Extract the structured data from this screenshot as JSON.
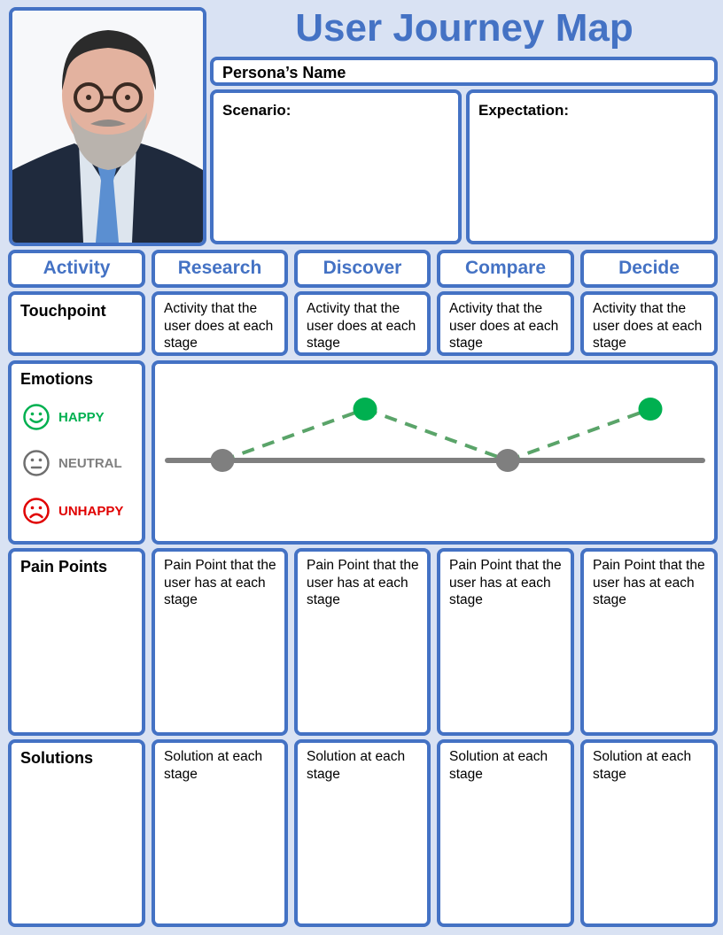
{
  "header": {
    "title": "User Journey Map",
    "persona_name_label": "Persona’s Name",
    "scenario_label": "Scenario:",
    "expectation_label": "Expectation:"
  },
  "photo": {
    "icon": "persona-photo",
    "alt": "Persona photo"
  },
  "activity_header": "Activity",
  "stages": [
    "Research",
    "Discover",
    "Compare",
    "Decide"
  ],
  "touchpoint": {
    "label": "Touchpoint",
    "cells": [
      "Activity that the user does at each stage",
      "Activity that the user does at each stage",
      "Activity that the user does at each stage",
      "Activity that the user does at each stage"
    ]
  },
  "emotions": {
    "label": "Emotions",
    "legend": [
      {
        "icon": "happy-face-icon",
        "label": "HAPPY",
        "color": "#00b050"
      },
      {
        "icon": "neutral-face-icon",
        "label": "NEUTRAL",
        "color": "#7f7f7f"
      },
      {
        "icon": "unhappy-face-icon",
        "label": "UNHAPPY",
        "color": "#e00000"
      }
    ]
  },
  "pain_points": {
    "label": "Pain Points",
    "cells": [
      "Pain Point that the user has at each stage",
      "Pain Point that the user has at each stage",
      "Pain Point that the user has at each stage",
      "Pain Point that the user has at each stage"
    ]
  },
  "solutions": {
    "label": "Solutions",
    "cells": [
      "Solution at each stage",
      "Solution at each stage",
      "Solution at each stage",
      "Solution at each stage"
    ]
  },
  "chart_data": {
    "type": "line",
    "title": "",
    "categories": [
      "Research",
      "Discover",
      "Compare",
      "Decide"
    ],
    "levels": [
      "UNHAPPY",
      "NEUTRAL",
      "HAPPY"
    ],
    "values": [
      "NEUTRAL",
      "HAPPY",
      "NEUTRAL",
      "HAPPY"
    ],
    "numeric_values": [
      0,
      1,
      0,
      1
    ],
    "ylim": [
      -1,
      1
    ],
    "baseline": "NEUTRAL",
    "colors": {
      "happy": "#00b050",
      "neutral": "#7f7f7f",
      "line": "#5aa469",
      "baseline": "#7f7f7f"
    }
  },
  "colors": {
    "accent": "#4472c4",
    "background": "#d9e2f3"
  }
}
